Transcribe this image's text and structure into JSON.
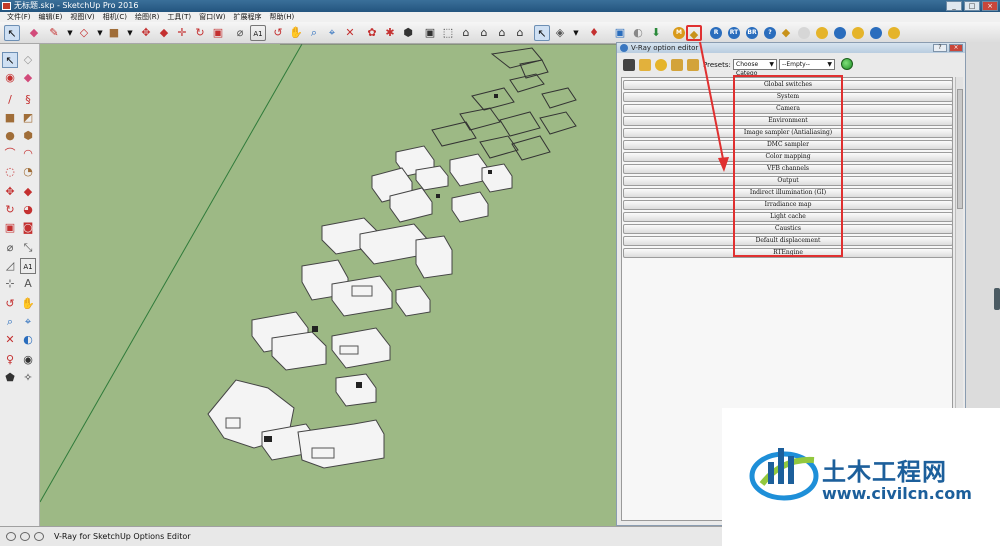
{
  "window": {
    "title": "无标题.skp - SketchUp Pro 2016"
  },
  "menu": [
    "文件(F)",
    "编辑(E)",
    "视图(V)",
    "相机(C)",
    "绘图(R)",
    "工具(T)",
    "窗口(W)",
    "扩展程序",
    "帮助(H)"
  ],
  "toolbar_icons": [
    "select-icon",
    "eraser-icon",
    "pencil-icon",
    "dropdown-icon",
    "shape-icon",
    "dropdown-icon",
    "paint-icon",
    "dropdown-icon",
    "move-icon",
    "pushpull-icon",
    "rotate-icon",
    "scale-icon",
    "tape-icon",
    "text-icon",
    "orbit-icon",
    "pan-icon",
    "zoom-icon",
    "zoom-extents-icon",
    "warehouse-icon",
    "extension-icon",
    "components-icon",
    "iso-view-icon",
    "top-view-icon",
    "front-view-icon",
    "right-view-icon",
    "back-view-icon",
    "left-view-icon",
    "select2-icon",
    "section-icon",
    "dropdown-icon",
    "camera-icon",
    "position-camera-icon",
    "walk-icon"
  ],
  "vray_toolbar_icons": [
    {
      "label": "M",
      "color": "#d99a1a"
    },
    {
      "label": "",
      "color": "#e5b42a"
    },
    {
      "label": "R",
      "color": "#2a6dbd"
    },
    {
      "label": "RT",
      "color": "#2a6dbd"
    },
    {
      "label": "BR",
      "color": "#2a6dbd"
    },
    {
      "label": "?",
      "color": "#2a6dbd"
    },
    {
      "label": "",
      "color": "#e5b42a"
    },
    {
      "label": "",
      "color": "#d6d6d6"
    },
    {
      "label": "",
      "color": "#e5b42a"
    },
    {
      "label": "",
      "color": "#2a6dbd"
    },
    {
      "label": "",
      "color": "#e5b42a"
    },
    {
      "label": "",
      "color": "#2a6dbd"
    }
  ],
  "status": {
    "text": "V-Ray for SketchUp Options Editor"
  },
  "dialog": {
    "title": "V-Ray option editor",
    "presets_label": "Presets:",
    "preset_category": "Choose Catego",
    "preset_value": "--Empty--",
    "rollouts": [
      "Global switches",
      "System",
      "Camera",
      "Environment",
      "Image sampler (Antialiasing)",
      "DMC sampler",
      "Color mapping",
      "VFB channels",
      "Output",
      "Indirect illumination (GI)",
      "Irradiance map",
      "Light cache",
      "Caustics",
      "Default displacement",
      "RTEngine"
    ]
  },
  "watermark": {
    "title": "土木工程网",
    "url": "www.civilcn.com"
  },
  "colors": {
    "viewport": "#9db985",
    "accent_red": "#e03030",
    "watermark_blue": "#1c5f9b"
  }
}
